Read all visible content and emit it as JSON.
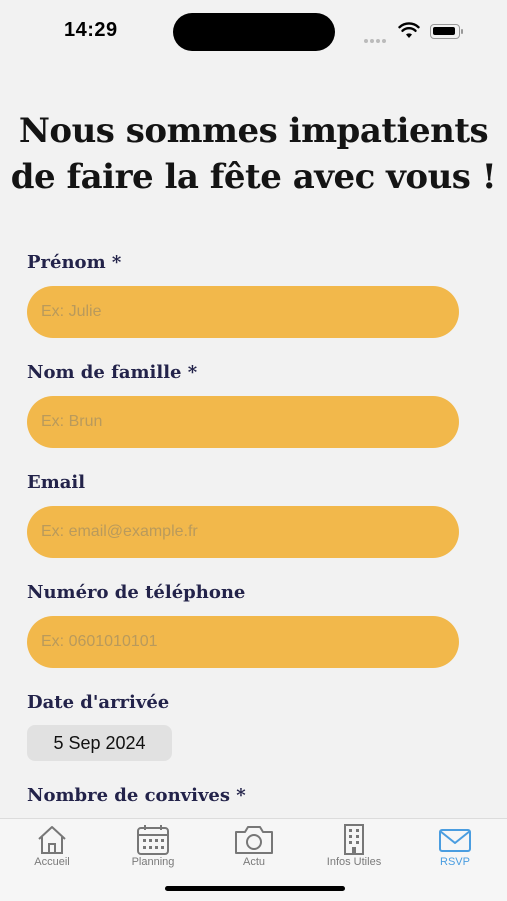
{
  "status_bar": {
    "time": "14:29"
  },
  "page": {
    "title_line1": "Nous sommes impatients",
    "title_line2": "de faire la fête avec vous !"
  },
  "form": {
    "first_name": {
      "label": "Prénom *",
      "placeholder": "Ex: Julie"
    },
    "last_name": {
      "label": "Nom de famille *",
      "placeholder": "Ex: Brun"
    },
    "email": {
      "label": "Email",
      "placeholder": "Ex: email@example.fr"
    },
    "phone": {
      "label": "Numéro de téléphone",
      "placeholder": "Ex: 0601010101"
    },
    "arrival_date": {
      "label": "Date d'arrivée",
      "value": "5 Sep 2024"
    },
    "guests": {
      "label": "Nombre de convives *"
    }
  },
  "tab_bar": {
    "tabs": [
      {
        "label": "Accueil",
        "icon": "home-icon"
      },
      {
        "label": "Planning",
        "icon": "calendar-icon"
      },
      {
        "label": "Actu",
        "icon": "camera-icon"
      },
      {
        "label": "Infos Utiles",
        "icon": "building-icon"
      },
      {
        "label": "RSVP",
        "icon": "mail-icon"
      }
    ],
    "active_tab": "RSVP"
  },
  "colors": {
    "accent": "#f2b84b",
    "active_tab": "#4a9de0",
    "label": "#23234a"
  }
}
